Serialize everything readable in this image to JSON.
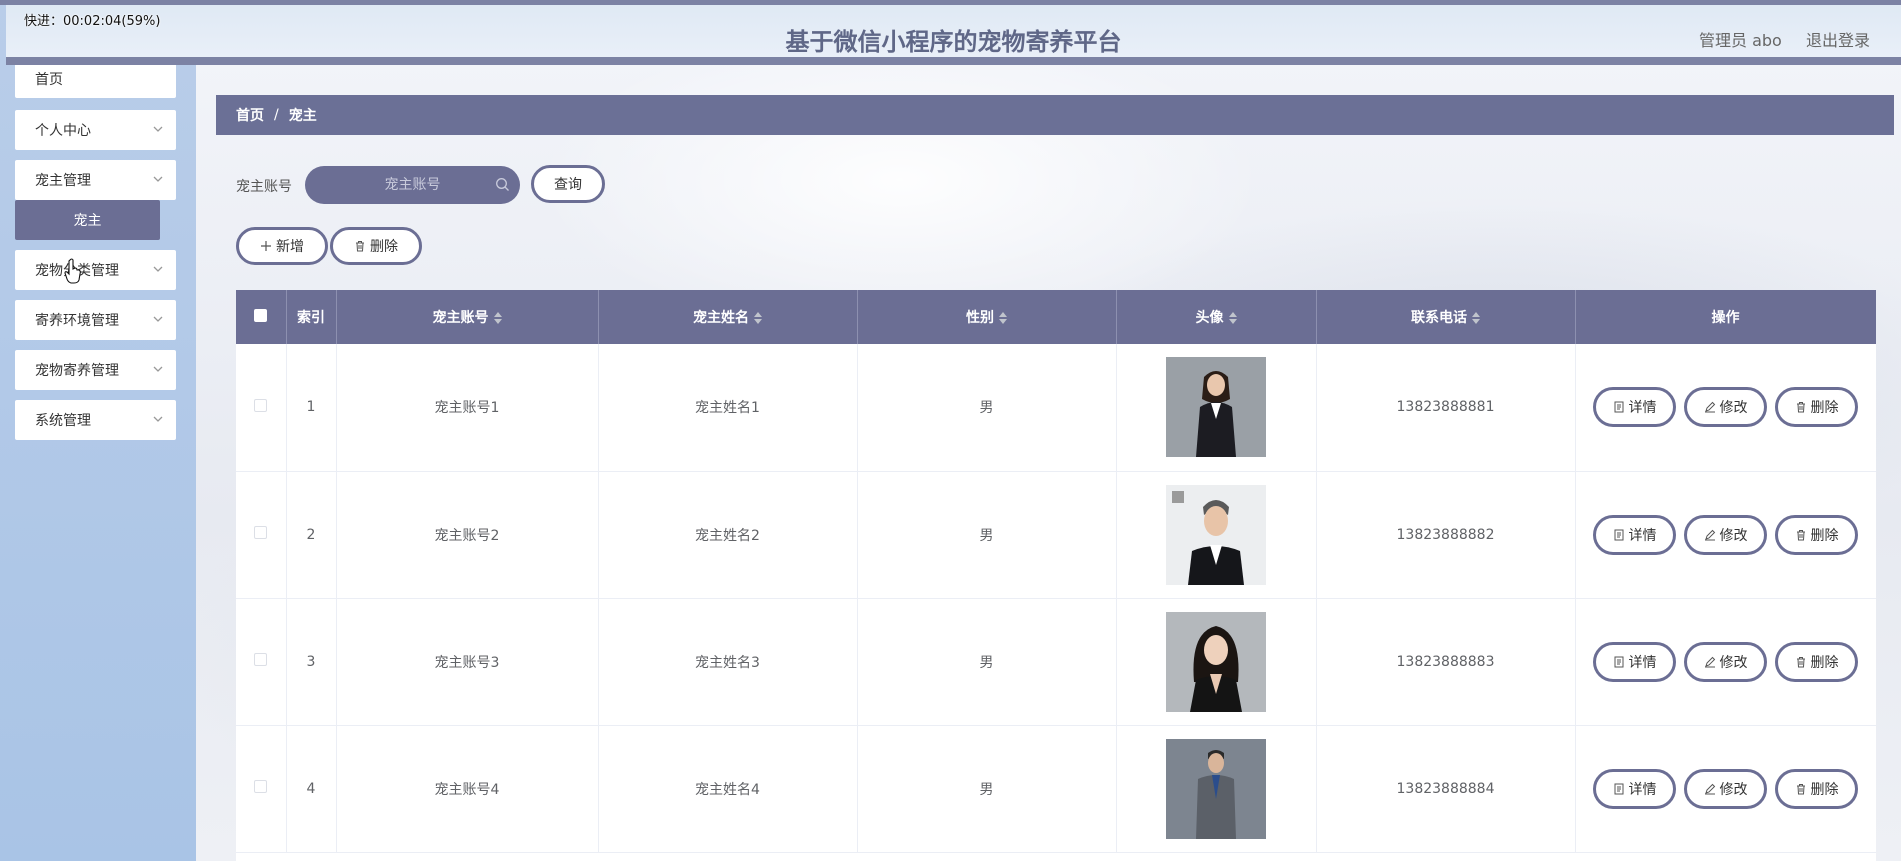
{
  "overlay": {
    "progress_text": "快进：00:02:04(59%)"
  },
  "header": {
    "title": "基于微信小程序的宠物寄养平台",
    "user_label": "管理员 abo",
    "logout_label": "退出登录"
  },
  "sidebar": {
    "items": [
      {
        "label": "首页"
      },
      {
        "label": "个人中心"
      },
      {
        "label": "宠主管理"
      },
      {
        "label": "宠物分类管理"
      },
      {
        "label": "寄养环境管理"
      },
      {
        "label": "宠物寄养管理"
      },
      {
        "label": "系统管理"
      }
    ],
    "active_submenu": "宠主"
  },
  "breadcrumb": {
    "home": "首页",
    "separator": "/",
    "current": "宠主"
  },
  "search": {
    "label": "宠主账号",
    "placeholder": "宠主账号",
    "button_label": "查询"
  },
  "toolbar": {
    "add_label": "新增",
    "delete_label": "删除"
  },
  "table": {
    "headers": [
      "索引",
      "宠主账号",
      "宠主姓名",
      "性别",
      "头像",
      "联系电话",
      "操作"
    ],
    "rows": [
      {
        "index": "1",
        "account": "宠主账号1",
        "name": "宠主姓名1",
        "gender": "男",
        "phone": "13823888881"
      },
      {
        "index": "2",
        "account": "宠主账号2",
        "name": "宠主姓名2",
        "gender": "男",
        "phone": "13823888882"
      },
      {
        "index": "3",
        "account": "宠主账号3",
        "name": "宠主姓名3",
        "gender": "男",
        "phone": "13823888883"
      },
      {
        "index": "4",
        "account": "宠主账号4",
        "name": "宠主姓名4",
        "gender": "男",
        "phone": "13823888884"
      }
    ],
    "actions": {
      "detail": "详情",
      "edit": "修改",
      "delete": "删除"
    }
  },
  "colors": {
    "accent": "#6b6e94",
    "sidebar": "#b0c8e8",
    "header_bar": "#7c82a4"
  }
}
